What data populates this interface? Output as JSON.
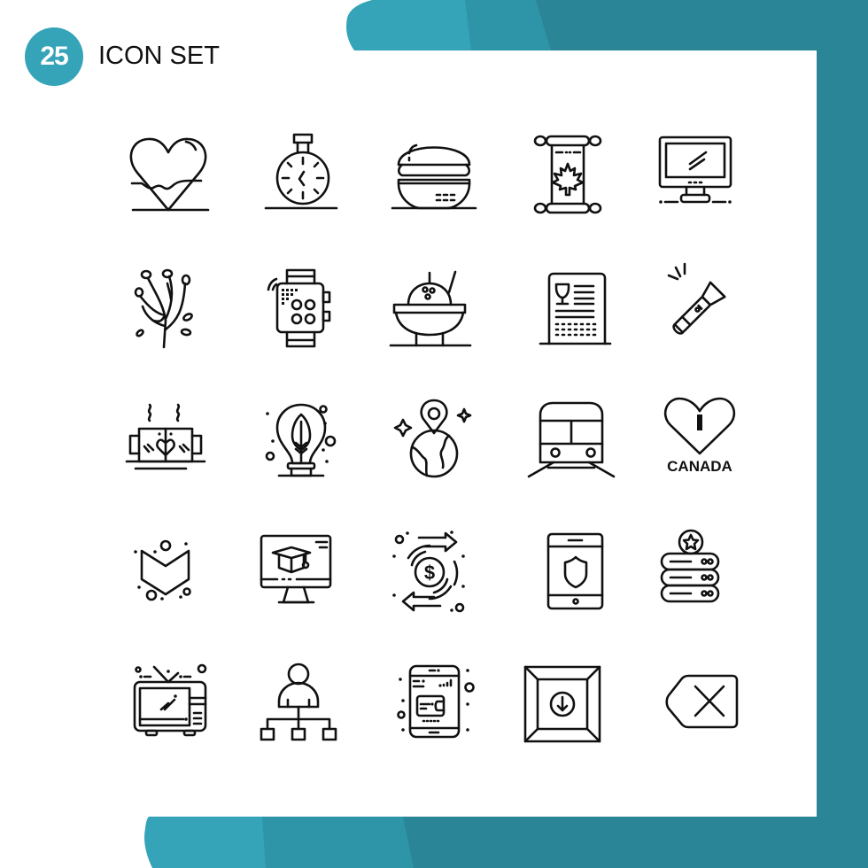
{
  "header": {
    "badge_number": "25",
    "title": "ICON SET"
  },
  "colors": {
    "teal_light": "#35a3b8",
    "teal_mid": "#2e95a8",
    "teal_dark": "#2a8596",
    "icon_stroke": "#111111",
    "panel": "#ffffff"
  },
  "icons": [
    {
      "name": "heart-water-icon"
    },
    {
      "name": "stopwatch-icon"
    },
    {
      "name": "burger-icon"
    },
    {
      "name": "canada-scroll-icon"
    },
    {
      "name": "monitor-icon"
    },
    {
      "name": "branch-berries-icon"
    },
    {
      "name": "smartwatch-icon"
    },
    {
      "name": "ice-cream-bowl-icon"
    },
    {
      "name": "wine-menu-icon"
    },
    {
      "name": "flashlight-icon"
    },
    {
      "name": "coffee-mugs-love-icon"
    },
    {
      "name": "eco-bulb-icon"
    },
    {
      "name": "globe-location-icon"
    },
    {
      "name": "train-icon"
    },
    {
      "name": "i-love-canada-icon",
      "label": "CANADA",
      "letter": "I"
    },
    {
      "name": "chevron-down-badge-icon"
    },
    {
      "name": "online-education-icon"
    },
    {
      "name": "money-exchange-icon"
    },
    {
      "name": "tablet-shield-icon"
    },
    {
      "name": "server-star-icon"
    },
    {
      "name": "retro-tv-icon"
    },
    {
      "name": "user-hierarchy-icon"
    },
    {
      "name": "mobile-wallet-icon"
    },
    {
      "name": "download-box-icon"
    },
    {
      "name": "backspace-clear-icon"
    }
  ]
}
